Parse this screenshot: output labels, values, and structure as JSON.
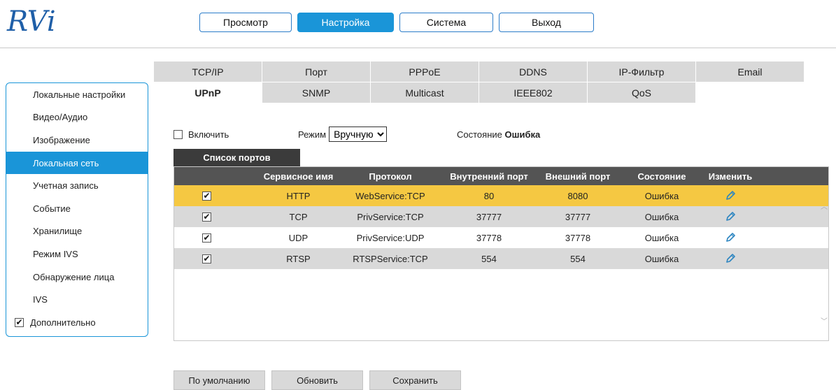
{
  "brand": {
    "logo_text": "RVi",
    "color": "#1f5fa8"
  },
  "topnav": {
    "items": [
      "Просмотр",
      "Настройка",
      "Система",
      "Выход"
    ],
    "active_index": 1
  },
  "sidebar": {
    "items": [
      "Локальные настройки",
      "Видео/Аудио",
      "Изображение",
      "Локальная сеть",
      "Учетная запись",
      "Событие",
      "Хранилище",
      "Режим IVS",
      "Обнаружение лица",
      "IVS"
    ],
    "active_index": 3,
    "advanced": {
      "label": "Дополнительно",
      "checked": true
    }
  },
  "tabs": {
    "row1": [
      "TCP/IP",
      "Порт",
      "PPPoE",
      "DDNS",
      "IP-Фильтр",
      "Email"
    ],
    "row2": [
      "UPnP",
      "SNMP",
      "Multicast",
      "IEEE802",
      "QoS"
    ],
    "active": "UPnP"
  },
  "controls": {
    "enable_label": "Включить",
    "enable_checked": false,
    "mode_label": "Режим",
    "mode_value": "Вручную",
    "state_label": "Состояние",
    "state_value": "Ошибка"
  },
  "port_list": {
    "title": "Список портов",
    "columns": [
      "",
      "Сервисное имя",
      "Протокол",
      "Внутренний порт",
      "Внешний порт",
      "Состояние",
      "Изменить"
    ],
    "rows": [
      {
        "checked": true,
        "service": "HTTP",
        "protocol": "WebService:TCP",
        "internal": "80",
        "external": "8080",
        "status": "Ошибка"
      },
      {
        "checked": true,
        "service": "TCP",
        "protocol": "PrivService:TCP",
        "internal": "37777",
        "external": "37777",
        "status": "Ошибка"
      },
      {
        "checked": true,
        "service": "UDP",
        "protocol": "PrivService:UDP",
        "internal": "37778",
        "external": "37778",
        "status": "Ошибка"
      },
      {
        "checked": true,
        "service": "RTSP",
        "protocol": "RTSPService:TCP",
        "internal": "554",
        "external": "554",
        "status": "Ошибка"
      }
    ],
    "selected_row": 0
  },
  "footer": {
    "default_label": "По умолчанию",
    "refresh_label": "Обновить",
    "save_label": "Сохранить"
  },
  "colors": {
    "accent": "#1a95d8",
    "selected_row": "#f5c842",
    "tab_bg": "#d9d9d9",
    "header_bg": "#545454",
    "pencil": "#2e86c1"
  }
}
